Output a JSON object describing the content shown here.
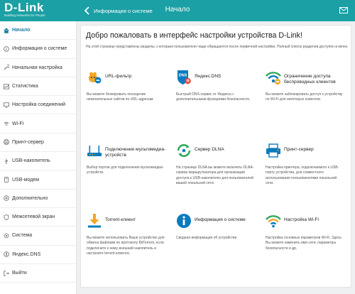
{
  "header": {
    "logo_text": "D-Link",
    "logo_tagline": "Building Networks for People",
    "back_label": "Информация о системе",
    "title": "Начало"
  },
  "sidebar": {
    "items": [
      {
        "label": "Начало",
        "icon": "home-icon",
        "active": true
      },
      {
        "label": "Информация о системе",
        "icon": "info-icon"
      },
      {
        "label": "Начальная настройка",
        "icon": "wrench-icon"
      },
      {
        "label": "Статистика",
        "icon": "stats-icon"
      },
      {
        "label": "Настройка соединений",
        "icon": "connections-icon"
      },
      {
        "label": "Wi-Fi",
        "icon": "wifi-icon"
      },
      {
        "label": "Принт-сервер",
        "icon": "printer-icon"
      },
      {
        "label": "USB-накопитель",
        "icon": "usb-icon"
      },
      {
        "label": "USB-модем",
        "icon": "usb-modem-icon"
      },
      {
        "label": "Дополнительно",
        "icon": "plus-icon"
      },
      {
        "label": "Межсетевой экран",
        "icon": "shield-icon"
      },
      {
        "label": "Система",
        "icon": "gear-icon"
      },
      {
        "label": "Яндекс.DNS",
        "icon": "yandex-icon"
      },
      {
        "label": "Выйти",
        "icon": "logout-icon"
      }
    ]
  },
  "main": {
    "welcome": "Добро пожаловать в интерфейс настройки устройства D-Link!",
    "intro": "На этой странице представлены разделы, к которым пользователи чаще обращаются после первичной настройки. Полный список разделов доступен в меню.",
    "tiles": [
      {
        "title": "URL-фильтр",
        "desc": "Вы можете блокировать посещение нежелательных сайтов по URL-адресам.",
        "icon": "url-filter-icon"
      },
      {
        "title": "Яндекс.DNS",
        "desc": "Быстрый DNS-сервис от Яндекса с дополнительными функциями безопасности.",
        "icon": "yandex-dns-icon"
      },
      {
        "title": "Ограничение доступа беспроводных клиентов",
        "desc": "Вы можете заблокировать доступ к устройству по Wi-Fi для некоторых клиентов.",
        "icon": "wifi-restrict-icon"
      },
      {
        "title": "Подключение мультимедиа-устройств",
        "desc": "Выбор портов для подключения мультимедиа-устройств.",
        "icon": "multimedia-icon"
      },
      {
        "title": "Сервер DLNA",
        "desc": "На странице DLNA вы можете включить DLNA-сервер маршрутизатора для организации доступа к USB-накопителю для пользователей вашей локальной сети.",
        "icon": "dlna-icon"
      },
      {
        "title": "Принт-сервер",
        "desc": "Настройка принтера, подключаемого к USB-порту устройства, для совместного использования пользователями локальной сети.",
        "icon": "print-server-icon"
      },
      {
        "title": "Torrent-клиент",
        "desc": "Вы можете использовать Ваше устройство для обмена файлами по протоколу BitTorrent, если подключите к нему внешний накопитель и настроите torrent-клиента.",
        "icon": "torrent-icon"
      },
      {
        "title": "Информация о системе",
        "desc": "Сводная информация об устройстве.",
        "icon": "system-info-icon"
      },
      {
        "title": "Настройка Wi-Fi",
        "desc": "Настройка основных параметров Wi-Fi. Здесь Вы можете изменить имя сети, параметры безопасности и др.",
        "icon": "wifi-settings-icon"
      }
    ]
  },
  "colors": {
    "header": "#1aa0a5",
    "accent_blue": "#0a7bbf",
    "accent_orange": "#f5a623",
    "accent_green": "#2eaa5c",
    "accent_red": "#e53935"
  }
}
